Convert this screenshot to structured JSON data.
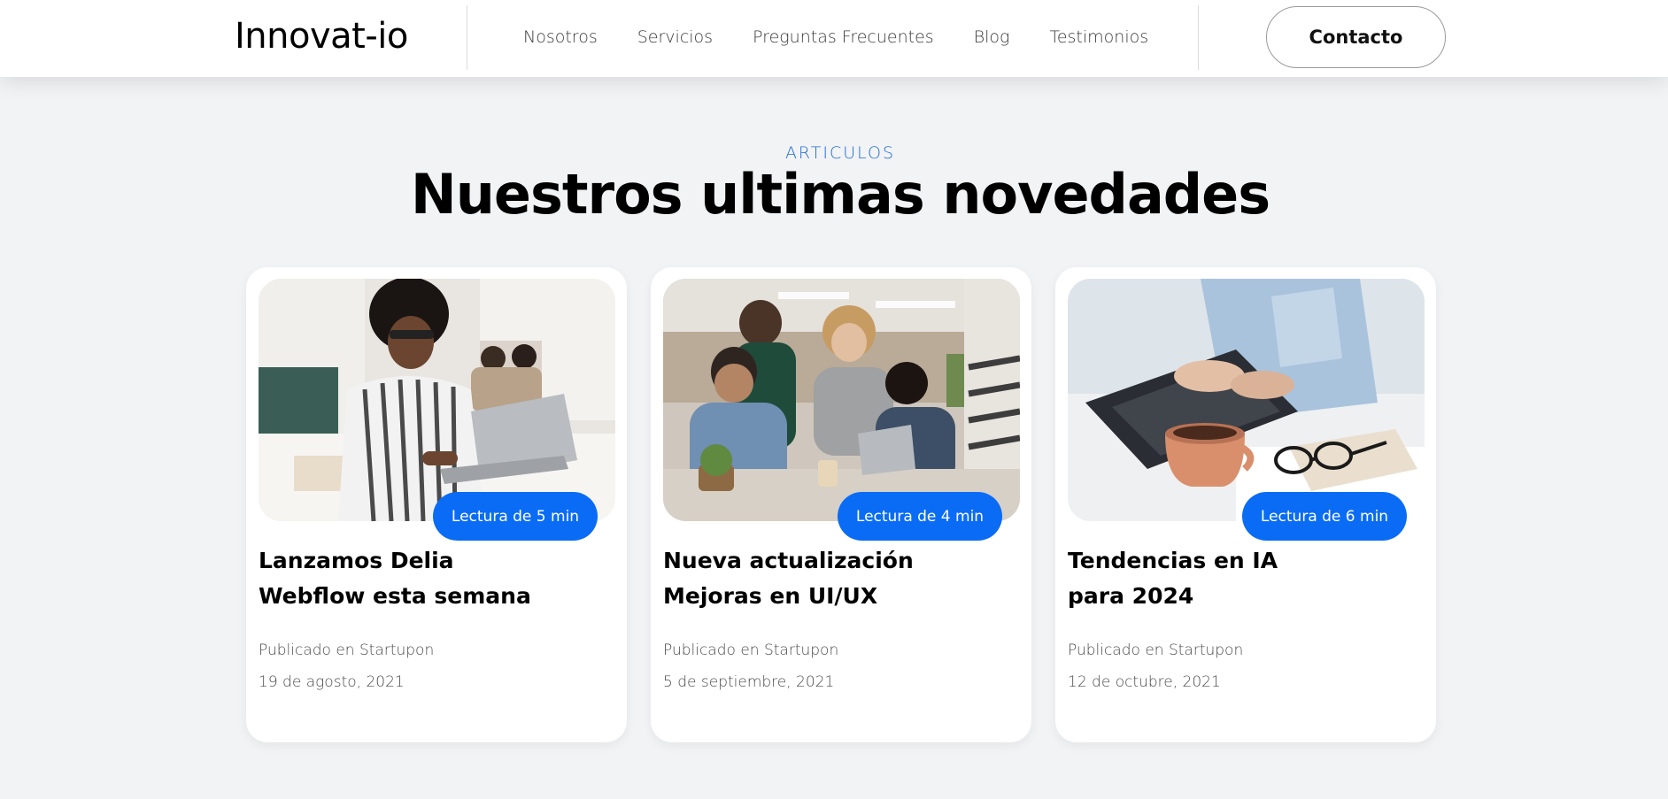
{
  "header": {
    "logo": "Innovat-io",
    "nav": [
      "Nosotros",
      "Servicios",
      "Preguntas Frecuentes",
      "Blog",
      "Testimonios"
    ],
    "contact_label": "Contacto"
  },
  "section": {
    "eyebrow": "ARTICULOS",
    "title": "Nuestros ultimas novedades"
  },
  "colors": {
    "accent": "#0a6cf5",
    "eyebrow": "#1e6bd6",
    "background": "#f2f3f5"
  },
  "articles": [
    {
      "badge": "Lectura de 5 min",
      "title_line1": "Lanzamos Delia",
      "title_line2": "Webflow esta semana",
      "published": "Publicado en Startupon",
      "date": "19 de agosto, 2021"
    },
    {
      "badge": "Lectura de 4 min",
      "title_line1": "Nueva actualización",
      "title_line2": "Mejoras en UI/UX",
      "published": "Publicado en Startupon",
      "date": "5 de septiembre, 2021"
    },
    {
      "badge": "Lectura de 6 min",
      "title_line1": "Tendencias en IA",
      "title_line2": "para 2024",
      "published": "Publicado en Startupon",
      "date": "12 de octubre, 2021"
    }
  ]
}
